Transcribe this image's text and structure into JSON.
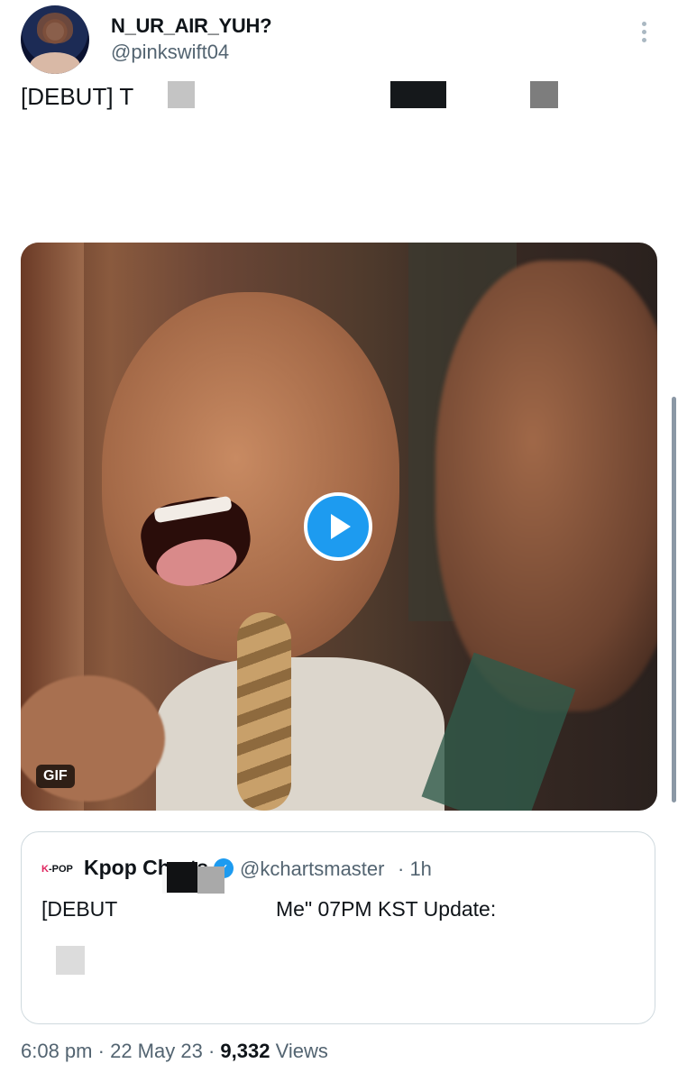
{
  "author": {
    "display_name": "N_UR_AIR_YUH?",
    "handle": "@pinkswift04"
  },
  "tweet": {
    "text": "[DEBUT] T"
  },
  "media": {
    "badge": "GIF"
  },
  "quoted_tweet": {
    "logo": {
      "k": "K",
      "rest": "-POP"
    },
    "name": "Kpop Charts",
    "verified_mark": "✓",
    "handle": "@kchartsmaster",
    "time": "· 1h",
    "text_start": "[DEBUT",
    "text_end": "Me\" 07PM KST Update:"
  },
  "meta": {
    "time": "6:08 pm",
    "sep1": "·",
    "date": "22 May 23",
    "sep2": "·",
    "views_count": "9,332",
    "views_label": "Views"
  },
  "colors": {
    "accent": "#1d9bf0",
    "secondary_text": "#536471"
  }
}
